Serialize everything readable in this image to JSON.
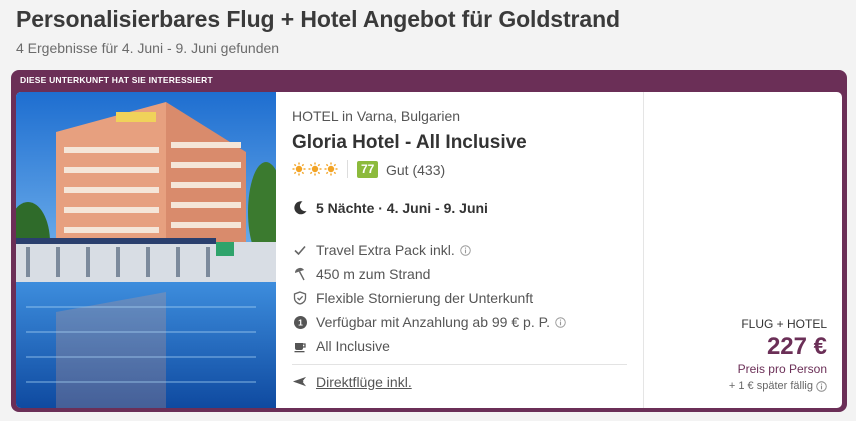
{
  "header": {
    "title": "Personalisierbares Flug + Hotel Angebot für Goldstrand",
    "subtitle": "4 Ergebnisse für 4. Juni - 9. Juni gefunden"
  },
  "card": {
    "frame_label": "DIESE UNTERKUNFT HAT SIE INTERESSIERT",
    "accent_color": "#6b2f57",
    "hotel": {
      "location": "HOTEL in Varna, Bulgarien",
      "name": "Gloria Hotel - All Inclusive",
      "stars": 3,
      "score": "77",
      "rating_text": "Gut (433)",
      "score_color": "#8cba3c"
    },
    "duration": "5 Nächte · 4. Juni - 9. Juni",
    "features": [
      {
        "icon": "check-icon",
        "label": "Travel Extra Pack inkl."
      },
      {
        "icon": "beach-umbrella-icon",
        "label": "450 m zum Strand"
      },
      {
        "icon": "shield-check-icon",
        "label": "Flexible Stornierung der Unterkunft"
      },
      {
        "icon": "deposit-icon",
        "label": "Verfügbar mit Anzahlung ab 99 € p. P."
      },
      {
        "icon": "all-inclusive-icon",
        "label": "All Inclusive"
      }
    ],
    "flight_link": "Direktflüge inkl.",
    "price": {
      "type": "FLUG + HOTEL",
      "amount": "227 €",
      "per": "Preis pro Person",
      "note": "+ 1 € später fällig"
    }
  }
}
